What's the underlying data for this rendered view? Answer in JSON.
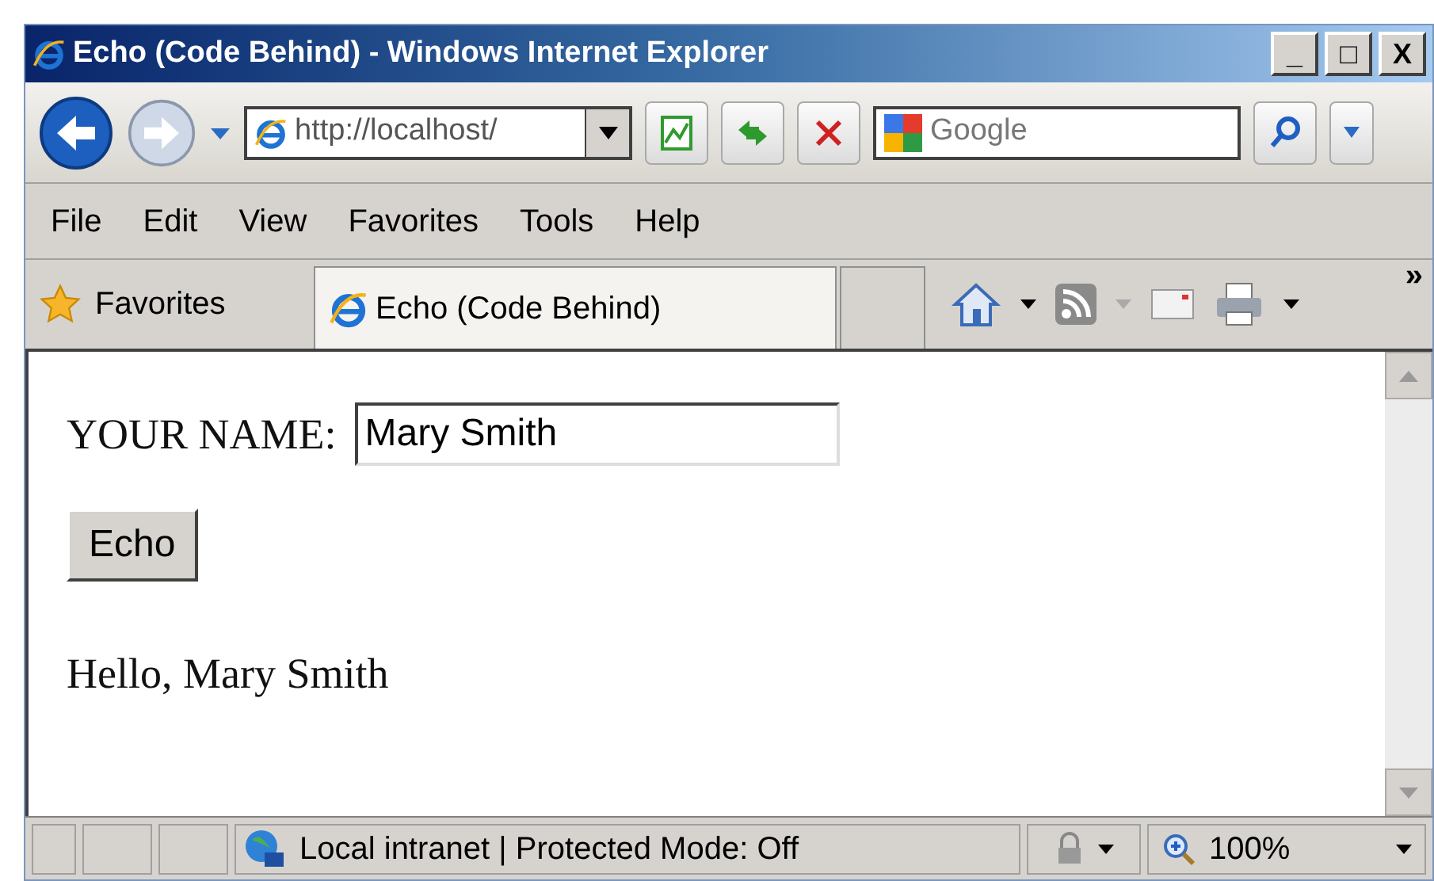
{
  "window": {
    "title": "Echo (Code Behind) - Windows Internet Explorer",
    "controls": [
      "_",
      "□",
      "X"
    ]
  },
  "address_bar": {
    "value": "http://localhost/"
  },
  "search": {
    "placeholder": "Google"
  },
  "menu": [
    "File",
    "Edit",
    "View",
    "Favorites",
    "Tools",
    "Help"
  ],
  "favorites_bar": {
    "label": "Favorites",
    "tab": "Echo (Code Behind)",
    "more": "»"
  },
  "page": {
    "name_label": "YOUR NAME:",
    "name_value": "Mary Smith",
    "button": "Echo",
    "output": "Hello, Mary Smith"
  },
  "status_bar": {
    "zone": "Local intranet | Protected Mode: Off",
    "zoom": "100%"
  }
}
